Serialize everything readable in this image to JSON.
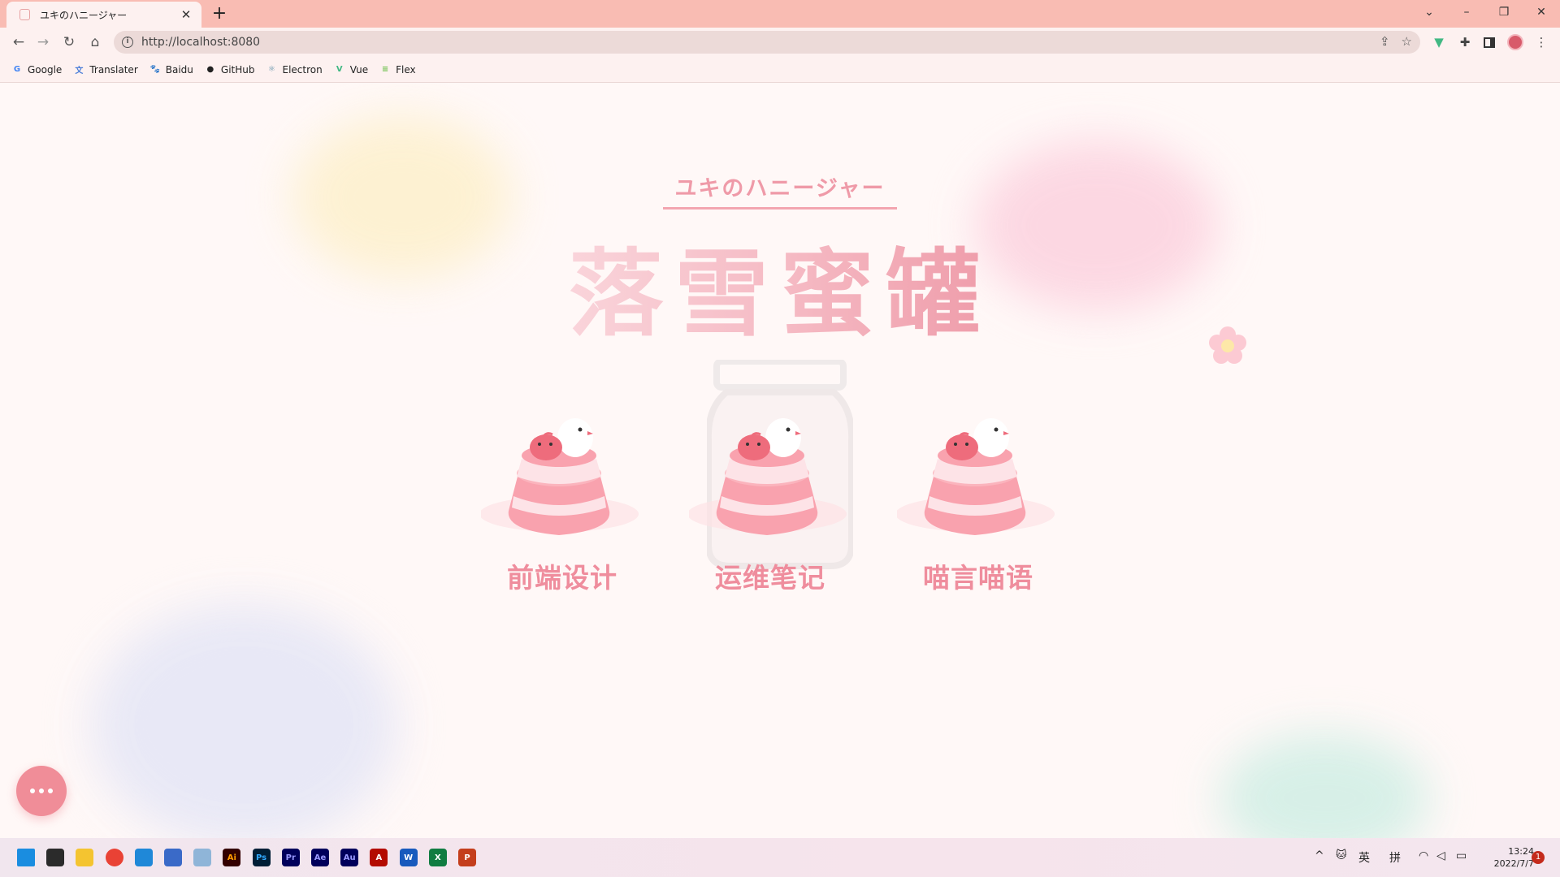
{
  "browser": {
    "tab_title": "ユキのハニージャー",
    "tab_close": "✕",
    "new_tab": "+",
    "url": "http://localhost:8080",
    "window_controls": [
      "⌄",
      "–",
      "❐",
      "✕"
    ],
    "bookmarks": [
      {
        "label": "Google",
        "icon": "google-icon",
        "color": "#4285f4",
        "glyph": "G"
      },
      {
        "label": "Translater",
        "icon": "translate-icon",
        "color": "#4a7dd8",
        "glyph": "文"
      },
      {
        "label": "Baidu",
        "icon": "baidu-icon",
        "color": "#2932e1",
        "glyph": "🐾"
      },
      {
        "label": "GitHub",
        "icon": "github-icon",
        "color": "#222222",
        "glyph": "●"
      },
      {
        "label": "Electron",
        "icon": "electron-icon",
        "color": "#5b8fa8",
        "glyph": "⚛"
      },
      {
        "label": "Vue",
        "icon": "vue-icon",
        "color": "#41b883",
        "glyph": "V"
      },
      {
        "label": "Flex",
        "icon": "flex-icon",
        "color": "#6cbf4a",
        "glyph": "≡"
      }
    ]
  },
  "page": {
    "subtitle": "ユキのハニージャー",
    "title": "落雪蜜罐",
    "cards": [
      {
        "label": "前端设计"
      },
      {
        "label": "运维笔记"
      },
      {
        "label": "喵言喵语"
      }
    ],
    "fab_icon": "more-dots-icon"
  },
  "taskbar": {
    "apps": [
      {
        "name": "start-icon",
        "label": "",
        "bg": "#1a8de0",
        "fg": "#ffffff"
      },
      {
        "name": "taskview-icon",
        "label": "",
        "bg": "#2b2b2b",
        "fg": "#ffffff"
      },
      {
        "name": "file-explorer-icon",
        "label": "",
        "bg": "#f4c430",
        "fg": "#ffffff"
      },
      {
        "name": "chrome-icon",
        "label": "",
        "bg": "#e94235",
        "fg": "#ffffff"
      },
      {
        "name": "vscode-icon",
        "label": "",
        "bg": "#1f88d8",
        "fg": "#ffffff"
      },
      {
        "name": "app-icon",
        "label": "",
        "bg": "#3a6ac8",
        "fg": "#ffffff"
      },
      {
        "name": "photos-icon",
        "label": "",
        "bg": "#8fb5d8",
        "fg": "#ffffff"
      },
      {
        "name": "illustrator-icon",
        "label": "Ai",
        "bg": "#330000",
        "fg": "#ff9a00"
      },
      {
        "name": "photoshop-icon",
        "label": "Ps",
        "bg": "#001e36",
        "fg": "#31a8ff"
      },
      {
        "name": "premiere-icon",
        "label": "Pr",
        "bg": "#00005b",
        "fg": "#9999ff"
      },
      {
        "name": "aftereffects-icon",
        "label": "Ae",
        "bg": "#00005b",
        "fg": "#9999ff"
      },
      {
        "name": "audition-icon",
        "label": "Au",
        "bg": "#00005b",
        "fg": "#9999ff"
      },
      {
        "name": "acrobat-icon",
        "label": "A",
        "bg": "#b30b00",
        "fg": "#ffffff"
      },
      {
        "name": "word-icon",
        "label": "W",
        "bg": "#185abd",
        "fg": "#ffffff"
      },
      {
        "name": "excel-icon",
        "label": "X",
        "bg": "#107c41",
        "fg": "#ffffff"
      },
      {
        "name": "powerpoint-icon",
        "label": "P",
        "bg": "#c43e1c",
        "fg": "#ffffff"
      }
    ],
    "ime_lang": "英",
    "ime_mode": "拼",
    "time": "13:24",
    "date": "2022/7/7",
    "notification_count": "1"
  }
}
